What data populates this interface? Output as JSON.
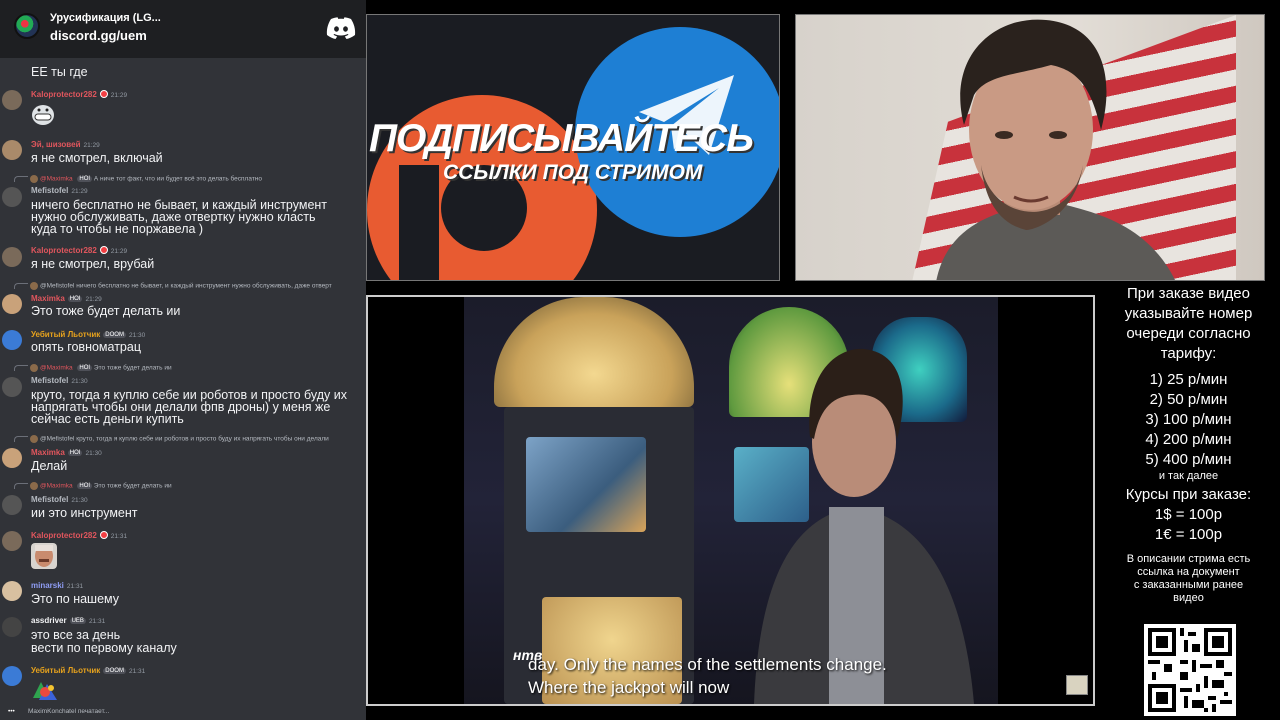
{
  "discord": {
    "server_name": "Урусификация (LG...",
    "invite": "discord.gg/uem",
    "typing_user": "MaximKonchatel",
    "typing_text": "печатает..."
  },
  "messages": [
    {
      "text": "ЕЕ ты где"
    },
    {
      "user": "Kaloprotector282",
      "color": "#e0565d",
      "time": "21:29",
      "emoji": "grin-emoji"
    },
    {
      "user": "Эй, шизовей",
      "color": "#e0565d",
      "time": "21:29",
      "text": "я не смотрел, включай"
    },
    {
      "reply_user": "@Maximka",
      "reply_text": "А ниче тот факт, что ии будет всё это делать бесплатно",
      "user": "Mefistofel",
      "color": "#b5bac1",
      "time": "21:29",
      "lines": [
        "ничего бесплатно не бывает, и каждый инструмент",
        "нужно обслуживать, даже отвертку нужно класть",
        "куда то чтобы не поржавела )"
      ]
    },
    {
      "user": "Kaloprotector282",
      "color": "#e0565d",
      "time": "21:29",
      "text": "я не смотрел, врубай"
    },
    {
      "reply_user": "@Mefistofel",
      "reply_text": "ничего бесплатно не бывает, и каждый инструмент нужно обслуживать, даже отверт",
      "user": "Maximka",
      "color": "#e0565d",
      "time": "21:29",
      "text": "Это тоже будет делать ии"
    },
    {
      "user": "Уебитый Льотчик",
      "color": "#e6a21d",
      "time": "21:30",
      "text": "опять говноматрац"
    },
    {
      "reply_user": "@Maximka",
      "reply_text": "Это тоже будет делать ии",
      "user": "Mefistofel",
      "color": "#b5bac1",
      "time": "21:30",
      "lines": [
        "круто, тогда я куплю себе ии роботов и просто буду их",
        "напрягать чтобы они делали фпв дроны) у меня же",
        "сейчас есть деньги купить"
      ]
    },
    {
      "reply_user": "@Mefistofel",
      "reply_text": "круто, тогда я куплю себе ии роботов и просто буду их напрягать чтобы они делали",
      "user": "Maximka",
      "color": "#e0565d",
      "time": "21:30",
      "text": "Делай"
    },
    {
      "reply_user": "@Maximka",
      "reply_text": "Это тоже будет делать ии",
      "user": "Mefistofel",
      "color": "#b5bac1",
      "time": "21:30",
      "text": "ии это инструмент"
    },
    {
      "user": "Kaloprotector282",
      "color": "#e0565d",
      "time": "21:31",
      "emoji": "face-sticker"
    },
    {
      "user": "minarski",
      "color": "#8f9df4",
      "time": "21:31",
      "text": "Это по нашему"
    },
    {
      "user": "assdriver",
      "color": "#f2f3f5",
      "time": "21:31",
      "lines": [
        "это все за день",
        "вести по первому каналу"
      ]
    },
    {
      "user": "Уебитый Льотчик",
      "color": "#e6a21d",
      "time": "21:31",
      "emoji": "colorful-sticker"
    }
  ],
  "badges": {
    "hoi": "HOI",
    "ueb": "UEB",
    "doom": "DOOM"
  },
  "banner": {
    "title": "ПОДПИСЫВАЙТЕСЬ",
    "subtitle": "ССЫЛКИ ПОД СТРИМОМ"
  },
  "video": {
    "subtitle_line1": "day. Only the names of the settlements change.",
    "subtitle_line2": "Where the jackpot will now",
    "channel_logo": "нтв"
  },
  "info": {
    "intro": [
      "При заказе видео",
      "указывайте номер",
      "очереди согласно",
      "тарифу:"
    ],
    "tariffs": [
      "1) 25 р/мин",
      "2) 50 р/мин",
      "3) 100 р/мин",
      "4) 200 р/мин",
      "5) 400 р/мин"
    ],
    "etc": "и так далее",
    "rates_title": "Курсы при заказе:",
    "rates": [
      "1$ = 100р",
      "1€ = 100р"
    ],
    "desc": [
      "В описании стрима есть",
      "ссылка на документ",
      "с заказанными ранее",
      "видео"
    ]
  }
}
